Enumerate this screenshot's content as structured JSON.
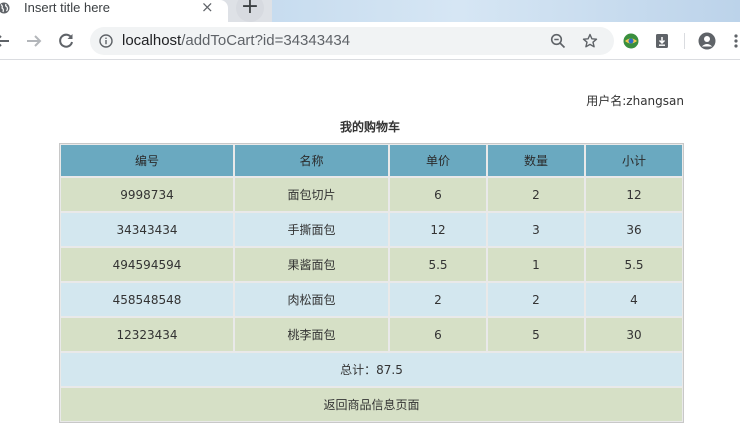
{
  "browser": {
    "tab_title": "Insert title here",
    "close_glyph": "×",
    "new_tab_glyph": "+",
    "url_host": "localhost",
    "url_path": "/addToCart?id=34343434",
    "icons": [
      "back-icon",
      "forward-icon",
      "reload-icon",
      "info-icon",
      "zoom-icon",
      "star-icon",
      "extension-icon",
      "save-icon",
      "profile-icon"
    ]
  },
  "page": {
    "username_label": "用户名:zhangsan",
    "title": "我的购物车",
    "columns": [
      "编号",
      "名称",
      "单价",
      "数量",
      "小计"
    ],
    "rows": [
      [
        "9998734",
        "面包切片",
        "6",
        "2",
        "12"
      ],
      [
        "34343434",
        "手撕面包",
        "12",
        "3",
        "36"
      ],
      [
        "494594594",
        "果酱面包",
        "5.5",
        "1",
        "5.5"
      ],
      [
        "458548548",
        "肉松面包",
        "2",
        "2",
        "4"
      ],
      [
        "12323434",
        "桃李面包",
        "6",
        "5",
        "30"
      ]
    ],
    "total_label": "总计：87.5",
    "back_link": "返回商品信息页面"
  },
  "colors": {
    "header_bg": "#6aa9c0",
    "row_green": "#d6e0c6",
    "row_blue": "#d3e7ef"
  }
}
